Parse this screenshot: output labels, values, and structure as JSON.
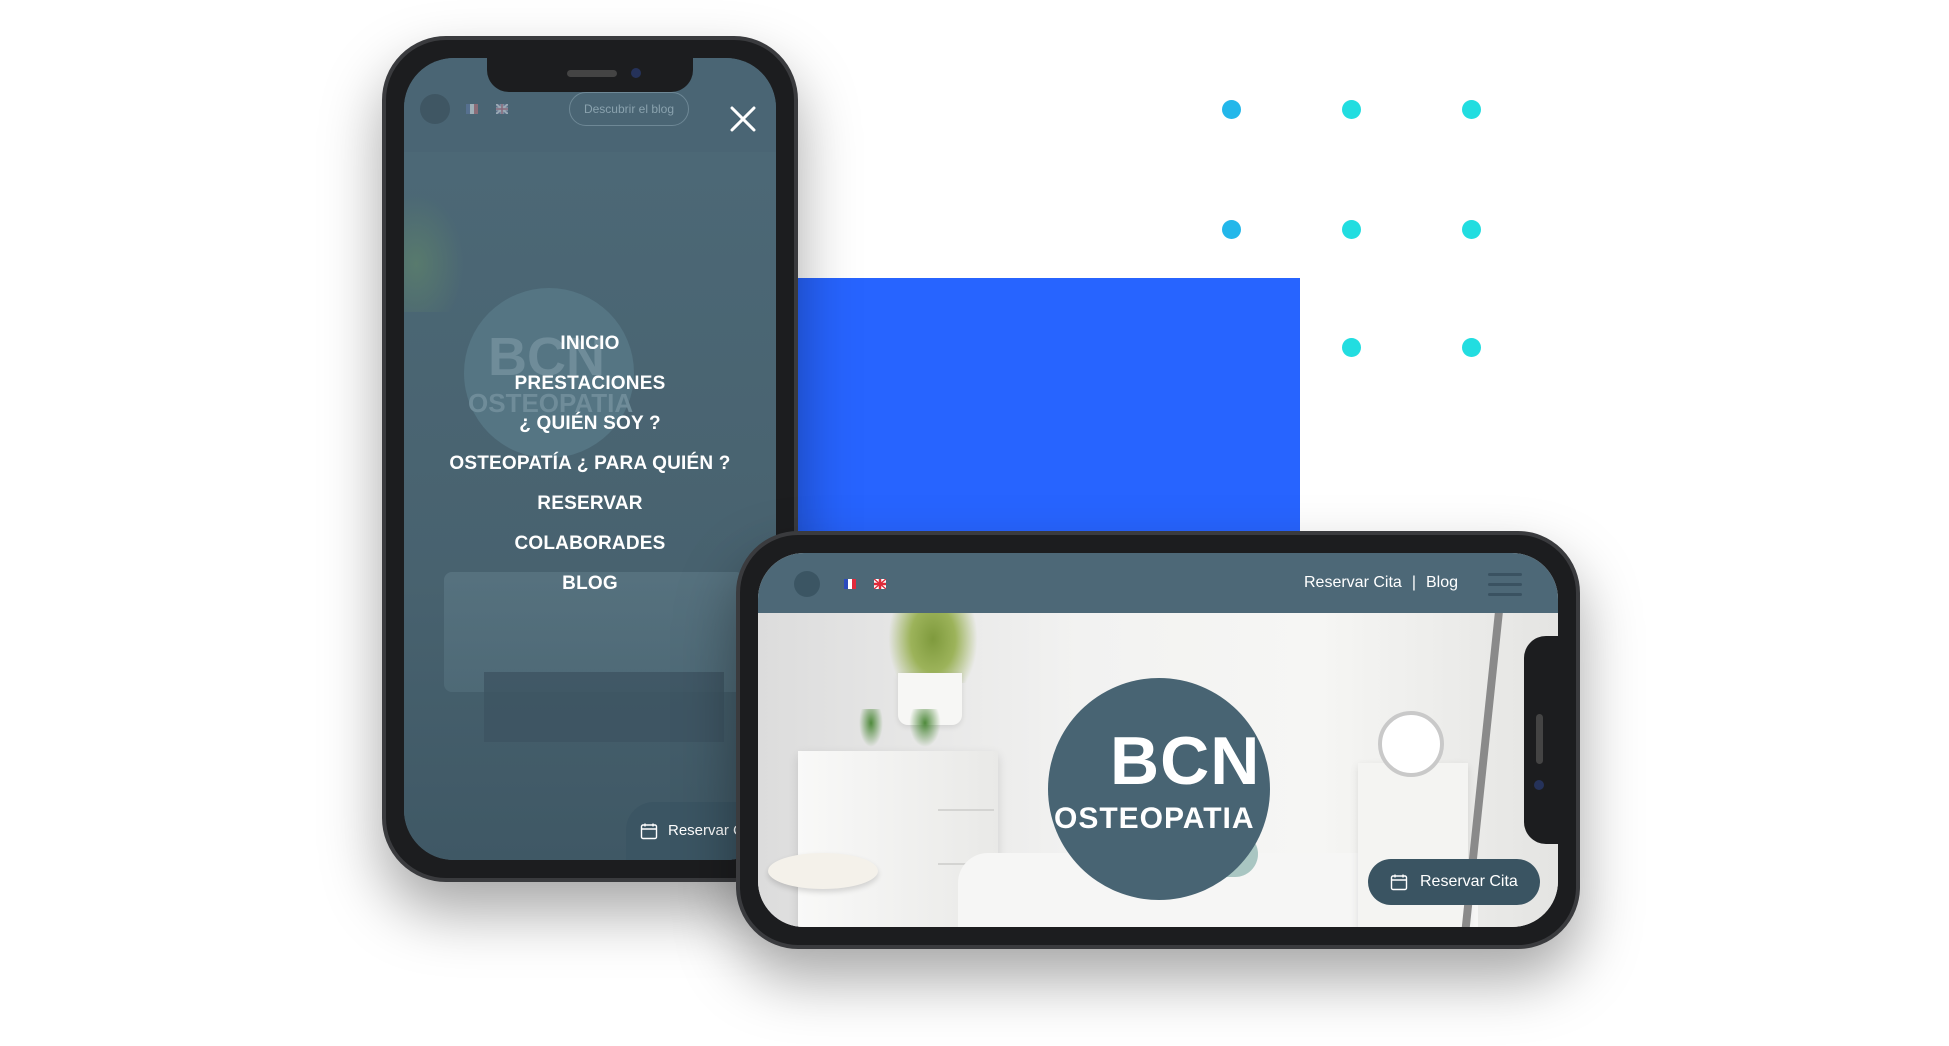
{
  "colors": {
    "accent_blue": "#2764ff",
    "dot_cyan": "#22dde0",
    "dot_blue": "#23b7ea",
    "overlay_teal": "#4e6b7a",
    "header_slate": "#4d6877"
  },
  "portrait": {
    "blog_button": "Descubrir el blog",
    "menu": [
      {
        "label": "INICIO"
      },
      {
        "label": "PRESTACIONES"
      },
      {
        "label": "¿ QUIÉN SOY ?"
      },
      {
        "label": "OSTEOPATÍA ¿ PARA QUIÉN ?"
      },
      {
        "label": "RESERVAR"
      },
      {
        "label": "COLABORADES"
      },
      {
        "label": "BLOG"
      }
    ],
    "cta": "Reservar Cita",
    "bg_logo_big": "BCN",
    "bg_logo_small": "OSTEOPATIA"
  },
  "landscape": {
    "nav_reserve": "Reservar Cita",
    "nav_separator": "|",
    "nav_blog": "Blog",
    "logo_big": "BCN",
    "logo_small": "OSTEOPATIA",
    "cta": "Reservar Cita"
  }
}
